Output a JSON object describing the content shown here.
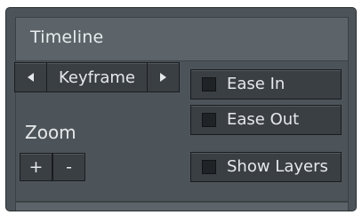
{
  "panel": {
    "title": "Timeline"
  },
  "keyframe_stepper": {
    "label": "Keyframe",
    "prev_icon": "triangle-left",
    "next_icon": "triangle-right"
  },
  "options": [
    {
      "label": "Ease In",
      "checked": false
    },
    {
      "label": "Ease Out",
      "checked": false
    },
    {
      "label": "Show Layers",
      "checked": false
    }
  ],
  "zoom": {
    "label": "Zoom",
    "in_label": "+",
    "out_label": "-"
  },
  "colors": {
    "panel_bg": "#4d5459",
    "header_bg": "#5c6469",
    "button_bg": "#3a3f43",
    "text": "#e6e9eb",
    "checkbox_bg": "#1f2326"
  }
}
